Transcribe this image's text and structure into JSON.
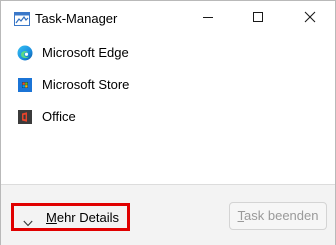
{
  "window": {
    "title": "Task-Manager",
    "icons": {
      "app": "task-manager-icon",
      "minimize": "minimize-icon",
      "maximize": "maximize-icon",
      "close": "close-icon"
    }
  },
  "apps": [
    {
      "label": "Microsoft Edge",
      "icon": "edge-icon"
    },
    {
      "label": "Microsoft Store",
      "icon": "store-icon"
    },
    {
      "label": "Office",
      "icon": "office-icon"
    }
  ],
  "footer": {
    "details": {
      "mnemonic": "M",
      "rest": "ehr Details",
      "icon": "chevron-down-icon",
      "highlight_color": "#e00000"
    },
    "end_task": {
      "mnemonic": "T",
      "rest": "ask beenden",
      "enabled": false
    }
  }
}
